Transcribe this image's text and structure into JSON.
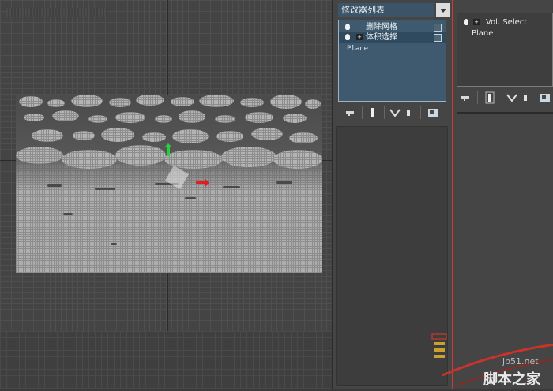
{
  "modifier_panel": {
    "dropdown_label": "修改器列表",
    "stack_items": [
      {
        "label": "删除网格"
      },
      {
        "label": "体积选择"
      }
    ],
    "base_object": "Plane"
  },
  "right_panel": {
    "stack_items": [
      {
        "label": "Vol. Select"
      },
      {
        "label": "Plane"
      }
    ]
  },
  "watermark": {
    "url": "jb51.net",
    "site_name": "脚本之家"
  },
  "colors": {
    "stack_bg": "#3f5a6e",
    "divider": "#d23a3a",
    "gizmo_y": "#27d13a",
    "gizmo_x": "#e02020"
  }
}
